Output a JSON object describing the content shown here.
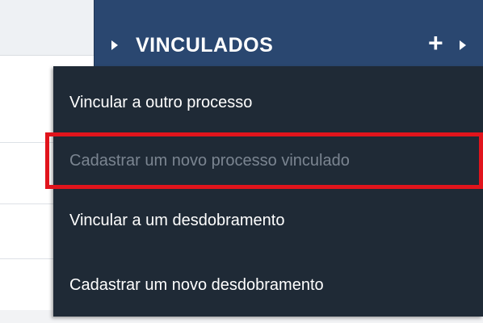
{
  "panel": {
    "title": "VINCULADOS",
    "add_label": "+",
    "accent_color": "#2a4770"
  },
  "menu": {
    "items": [
      {
        "label": "Vincular a outro processo",
        "enabled": true
      },
      {
        "label": "Cadastrar um novo processo vinculado",
        "enabled": false
      },
      {
        "label": "Vincular a um desdobramento",
        "enabled": true
      },
      {
        "label": "Cadastrar um novo desdobramento",
        "enabled": true
      }
    ]
  },
  "annotation": {
    "highlight_color": "#e1141c",
    "highlighted_item": "Cadastrar um novo processo vinculado"
  }
}
